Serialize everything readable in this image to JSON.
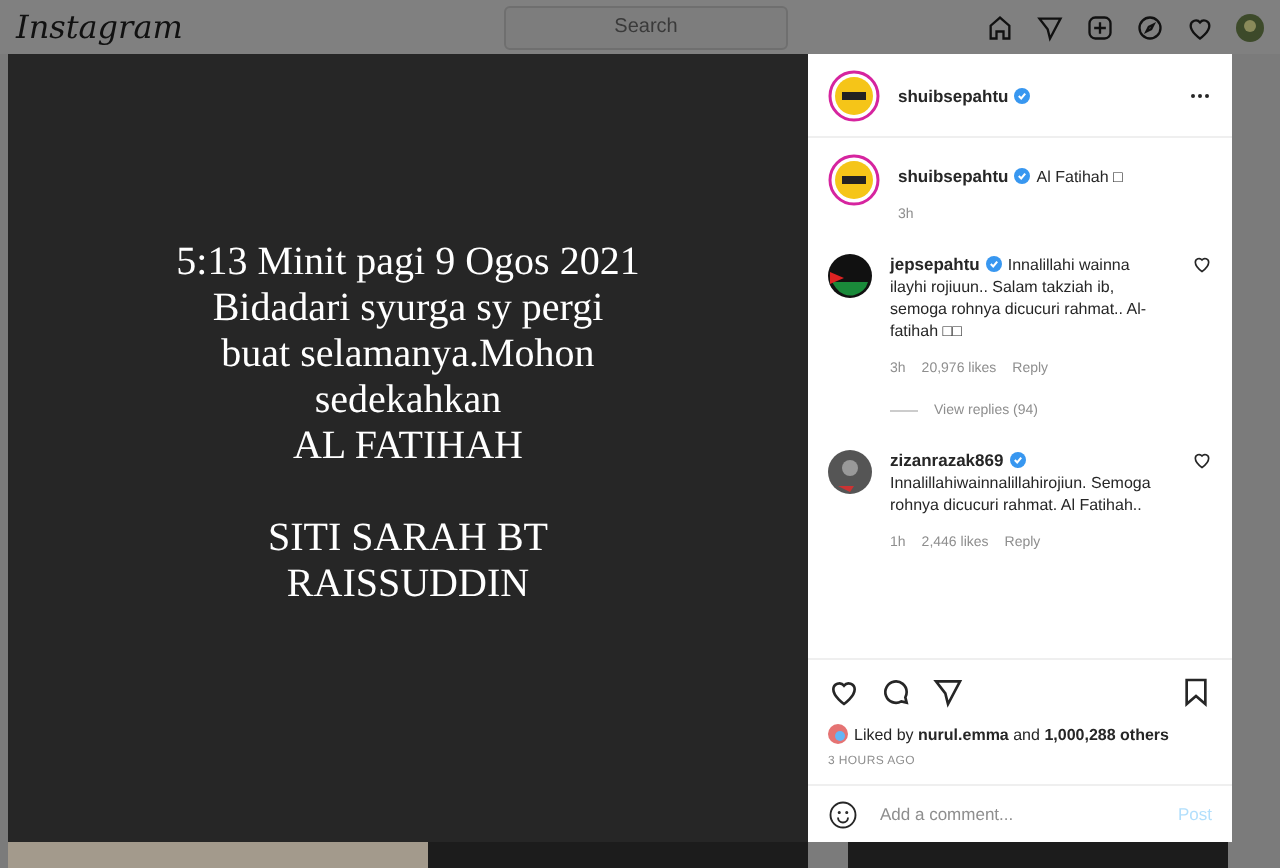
{
  "top_bar": {
    "logo": "Instagram",
    "search": {
      "placeholder": "Search"
    }
  },
  "post": {
    "paragraphs": [
      [
        "5:13 Minit pagi 9 Ogos 2021",
        "Bidadari syurga sy pergi",
        "buat selamanya.Mohon",
        "sedekahkan",
        "AL FATIHAH"
      ],
      [
        "SITI SARAH BT",
        "RAISSUDDIN"
      ]
    ]
  },
  "panel": {
    "author": {
      "username": "shuibsepahtu",
      "verified": true
    },
    "caption": {
      "username": "shuibsepahtu",
      "verified": true,
      "text": "Al Fatihah □",
      "time": "3h"
    },
    "comments": [
      {
        "username": "jepsepahtu",
        "verified": true,
        "text": "Innalillahi wainna ilayhi rojiuun.. Salam takziah ib, semoga rohnya dicucuri rahmat.. Al-fatihah □□",
        "time": "3h",
        "likes": "20,976 likes",
        "reply": "Reply",
        "view_replies": "View replies (94)",
        "liked": false
      },
      {
        "username": "zizanrazak869",
        "verified": true,
        "text": "Innalillahiwainnalillahirojiun. Semoga rohnya dicucuri rahmat. Al Fatihah..",
        "time": "1h",
        "likes": "2,446 likes",
        "reply": "Reply",
        "liked": false
      }
    ],
    "liked_by": {
      "prefix": "Liked by",
      "user": "nurul.emma",
      "middle": "and",
      "others": "1,000,288 others"
    },
    "posted": "3 HOURS AGO",
    "comment_field": {
      "placeholder": "Add a comment...",
      "post": "Post"
    }
  }
}
